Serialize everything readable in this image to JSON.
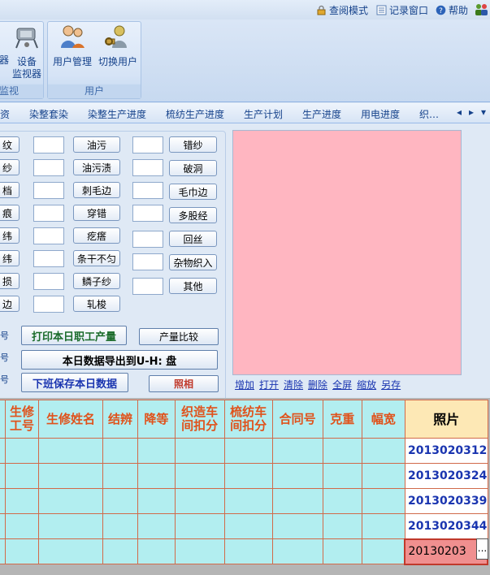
{
  "topbar": {
    "read_mode": "查阅模式",
    "record_window": "记录窗口",
    "help": "帮助"
  },
  "ribbon": {
    "group_monitor": {
      "title": "监视",
      "partial_button": "器",
      "device_monitor_line1": "设备",
      "device_monitor_line2": "监视器"
    },
    "group_user": {
      "title": "用户",
      "user_manage": "用户管理",
      "switch_user": "切换用户"
    }
  },
  "tabs": [
    "资",
    "染整套染",
    "染整生产进度",
    "梳纺生产进度",
    "生产计划",
    "生产进度",
    "用电进度",
    "织…"
  ],
  "nav": {
    "prev": "◂",
    "next": "▸",
    "menu": "▾"
  },
  "defects": {
    "col1": [
      "纹",
      "纱",
      "档",
      "痕",
      "纬",
      "纬",
      "损",
      "边"
    ],
    "col2": [
      "油污",
      "油污渍",
      "刺毛边",
      "穿错",
      "疙瘩",
      "条干不匀",
      "鳞子纱",
      "轧梭"
    ],
    "col3": [
      "错纱",
      "破洞",
      "毛巾边",
      "多股经",
      "回丝",
      "杂物织入",
      "其他"
    ]
  },
  "actions": {
    "print_daily": "打印本日职工产量",
    "compare": "产量比较",
    "export": "本日数据导出到U-H: 盘",
    "save_shift": "下班保存本日数据",
    "photo": "照相",
    "side_marks": [
      "号",
      "号",
      "号"
    ]
  },
  "photo_links": [
    "增加",
    "打开",
    "清除",
    "删除",
    "全屏",
    "缩放",
    "另存"
  ],
  "grid": {
    "headers": [
      "",
      "生修\n工号",
      "生修姓名",
      "结辨",
      "降等",
      "织造车\n间扣分",
      "梳纺车\n间扣分",
      "合同号",
      "克重",
      "幅宽",
      "照片"
    ],
    "photo_values": [
      "2013020312",
      "2013020324",
      "2013020339",
      "2013020344",
      "20130203"
    ],
    "ellipsis": "..."
  },
  "colors": {
    "grid_fill": "#b2eef0",
    "grid_border": "#d16a4a",
    "header_text": "#e0521b",
    "photo_area": "#ffb6c1",
    "selected_cell": "#f08f8f"
  }
}
